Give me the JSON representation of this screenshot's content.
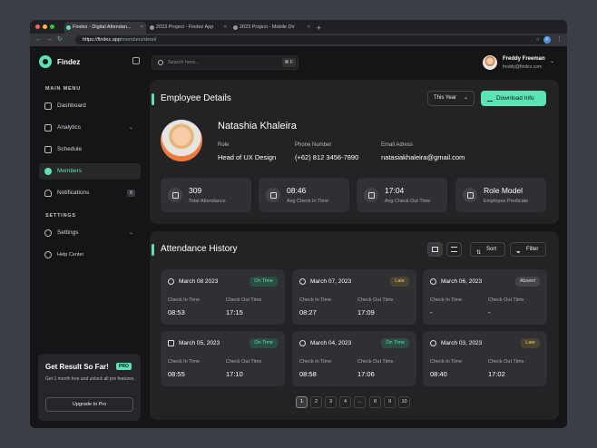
{
  "browser": {
    "tabs": [
      {
        "title": "Findez - Digital Attendan..."
      },
      {
        "title": "2023 Project - Findez App"
      },
      {
        "title": "2023 Project - Mobile Dir"
      }
    ],
    "url_host": "https://findez.app",
    "url_path": "/members/detail",
    "profile_initial": "F"
  },
  "sidebar": {
    "brand": "Findez",
    "main_menu_title": "MAIN MENU",
    "items": [
      {
        "label": "Dashboard"
      },
      {
        "label": "Analytics"
      },
      {
        "label": "Schedule"
      },
      {
        "label": "Members"
      },
      {
        "label": "Notifications",
        "badge": "8"
      }
    ],
    "settings_title": "SETTINGS",
    "settings_items": [
      {
        "label": "Settings"
      },
      {
        "label": "Help Center"
      }
    ],
    "promo": {
      "title": "Get Result So Far!",
      "badge": "PRO",
      "text": "Get 1 month free and unlock all pro features.",
      "button": "Upgrade to Pro"
    }
  },
  "topbar": {
    "search_placeholder": "Search here...",
    "shortcut": "⌘ F",
    "user_name": "Freddy Freeman",
    "user_email": "freddy@findez.com"
  },
  "employee": {
    "title": "Employee Details",
    "period": "This Year",
    "download": "Download Info",
    "name": "Natashia Khaleira",
    "fields": [
      {
        "label": "Role",
        "value": "Head of UX Design"
      },
      {
        "label": "Phone Number",
        "value": "(+62) 812 3456-7890"
      },
      {
        "label": "Email Adress",
        "value": "natasiakhaleira@gmail.com"
      }
    ],
    "stats": [
      {
        "value": "309",
        "label": "Total Attendance"
      },
      {
        "value": "08:46",
        "label": "Avg Check In Time"
      },
      {
        "value": "17:04",
        "label": "Avg Check Out Time"
      },
      {
        "value": "Role Model",
        "label": "Employee Predicate"
      }
    ]
  },
  "attendance": {
    "title": "Attendance History",
    "sort": "Sort",
    "filter": "Filter",
    "check_in_label": "Check In Time",
    "check_out_label": "Check Out Time",
    "records": [
      {
        "date": "March 08 2023",
        "status": "On Time",
        "in": "08:53",
        "out": "17:15"
      },
      {
        "date": "March 07, 2023",
        "status": "Late",
        "in": "08:27",
        "out": "17:09"
      },
      {
        "date": "March 06, 2023",
        "status": "Absent",
        "in": "-",
        "out": "-"
      },
      {
        "date": "March 05, 2023",
        "status": "On Time",
        "in": "08:55",
        "out": "17:10"
      },
      {
        "date": "March 04, 2023",
        "status": "On Time",
        "in": "08:58",
        "out": "17:06"
      },
      {
        "date": "March 03, 2023",
        "status": "Late",
        "in": "08:40",
        "out": "17:02"
      }
    ],
    "pages": [
      "1",
      "2",
      "3",
      "4",
      "...",
      "8",
      "9",
      "10"
    ],
    "current_page": "1"
  },
  "colors": {
    "accent": "#5be3b4",
    "late": "#f1c96a",
    "background": "#151517",
    "card": "#232326"
  }
}
